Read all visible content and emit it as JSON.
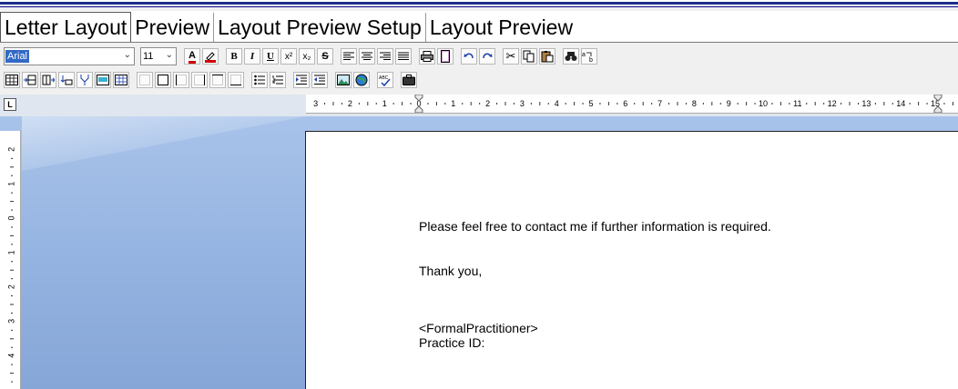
{
  "tabs": [
    {
      "label": "Letter Layout",
      "active": true
    },
    {
      "label": "Preview",
      "active": false
    },
    {
      "label": "Layout Preview Setup",
      "active": false
    },
    {
      "label": "Layout Preview",
      "active": false
    }
  ],
  "toolbar": {
    "font_name": "Arial",
    "font_size": "11",
    "icons_row1": [
      "font-color-icon",
      "highlight-icon",
      "bold-icon",
      "italic-icon",
      "underline-icon",
      "superscript-icon",
      "subscript-icon",
      "strikethrough-icon",
      "align-left-icon",
      "align-center-icon",
      "align-right-icon",
      "justify-icon",
      "print-icon",
      "page-icon",
      "undo-icon",
      "redo-icon",
      "cut-icon",
      "copy-icon",
      "paste-icon",
      "find-icon",
      "replace-icon"
    ],
    "labels": {
      "bold": "B",
      "italic": "I",
      "underline": "U",
      "superscript": "x²",
      "subscript": "x₂",
      "strike": "S",
      "font_color": "A"
    }
  },
  "ruler": {
    "h_numbers": [
      "3",
      "2",
      "1",
      "0",
      "1",
      "2",
      "3",
      "4",
      "5",
      "6",
      "7",
      "8",
      "9",
      "10",
      "11",
      "12",
      "13",
      "14",
      "15"
    ],
    "v_numbers": [
      "2",
      "1",
      "0",
      "1",
      "2",
      "3",
      "4"
    ],
    "corner": "L"
  },
  "document": {
    "lines": [
      "Please feel free to contact me if further information is required.",
      "Thank you,",
      "<FormalPractitioner>",
      "Practice ID:"
    ]
  },
  "colors": {
    "workspace": "#92b1df",
    "accent": "#1f2f8a",
    "selection": "#3169c6"
  }
}
